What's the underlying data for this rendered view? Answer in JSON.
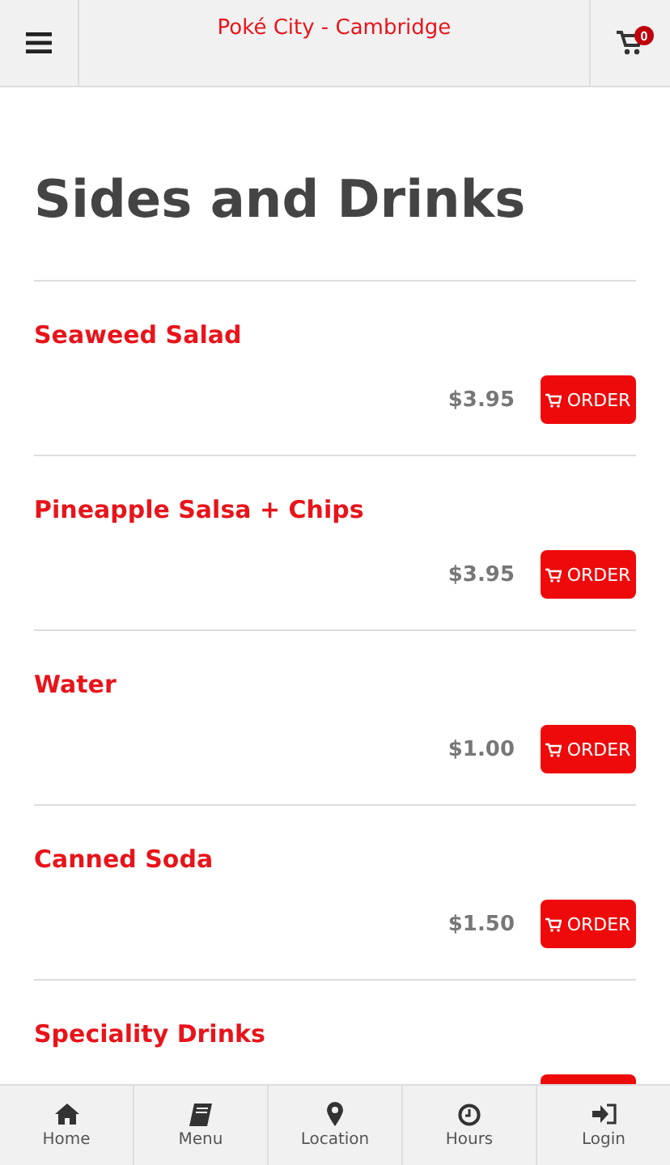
{
  "header": {
    "title": "Poké City - Cambridge",
    "cart_count": "0"
  },
  "page_title": "Sides and Drinks",
  "items": [
    {
      "name": "Seaweed Salad",
      "price": "$3.95",
      "order_label": "ORDER"
    },
    {
      "name": "Pineapple Salsa + Chips",
      "price": "$3.95",
      "order_label": "ORDER"
    },
    {
      "name": "Water",
      "price": "$1.00",
      "order_label": "ORDER"
    },
    {
      "name": "Canned Soda",
      "price": "$1.50",
      "order_label": "ORDER"
    },
    {
      "name": "Speciality Drinks"
    }
  ],
  "nav": [
    {
      "kind": "home",
      "label": "Home"
    },
    {
      "kind": "menu",
      "label": "Menu"
    },
    {
      "kind": "location",
      "label": "Location"
    },
    {
      "kind": "hours",
      "label": "Hours"
    },
    {
      "kind": "login",
      "label": "Login"
    }
  ]
}
